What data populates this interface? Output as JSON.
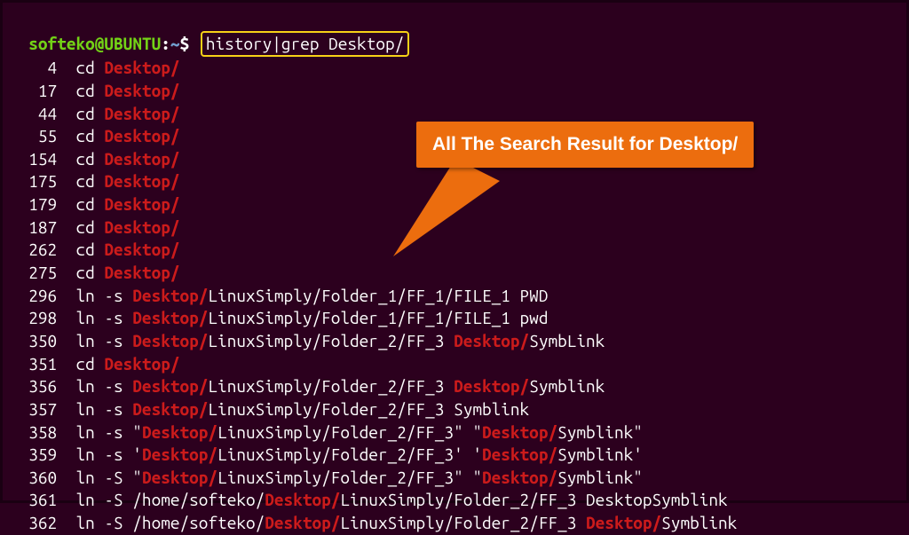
{
  "prompt": {
    "user": "softeko",
    "at": "@",
    "host": "UBUNTU",
    "colon": ":",
    "path": "~",
    "dollar": "$",
    "command": "history|grep Desktop/"
  },
  "callout": {
    "text": "All The Search Result for Desktop/"
  },
  "history": [
    {
      "n": "4",
      "segs": [
        {
          "t": "cd ",
          "m": 0
        },
        {
          "t": "Desktop/",
          "m": 1
        }
      ]
    },
    {
      "n": "17",
      "segs": [
        {
          "t": "cd ",
          "m": 0
        },
        {
          "t": "Desktop/",
          "m": 1
        }
      ]
    },
    {
      "n": "44",
      "segs": [
        {
          "t": "cd ",
          "m": 0
        },
        {
          "t": "Desktop/",
          "m": 1
        }
      ]
    },
    {
      "n": "55",
      "segs": [
        {
          "t": "cd ",
          "m": 0
        },
        {
          "t": "Desktop/",
          "m": 1
        }
      ]
    },
    {
      "n": "154",
      "segs": [
        {
          "t": "cd ",
          "m": 0
        },
        {
          "t": "Desktop/",
          "m": 1
        }
      ]
    },
    {
      "n": "175",
      "segs": [
        {
          "t": "cd ",
          "m": 0
        },
        {
          "t": "Desktop/",
          "m": 1
        }
      ]
    },
    {
      "n": "179",
      "segs": [
        {
          "t": "cd ",
          "m": 0
        },
        {
          "t": "Desktop/",
          "m": 1
        }
      ]
    },
    {
      "n": "187",
      "segs": [
        {
          "t": "cd ",
          "m": 0
        },
        {
          "t": "Desktop/",
          "m": 1
        }
      ]
    },
    {
      "n": "262",
      "segs": [
        {
          "t": "cd ",
          "m": 0
        },
        {
          "t": "Desktop/",
          "m": 1
        }
      ]
    },
    {
      "n": "275",
      "segs": [
        {
          "t": "cd ",
          "m": 0
        },
        {
          "t": "Desktop/",
          "m": 1
        }
      ]
    },
    {
      "n": "296",
      "segs": [
        {
          "t": "ln -s ",
          "m": 0
        },
        {
          "t": "Desktop/",
          "m": 1
        },
        {
          "t": "LinuxSimply/Folder_1/FF_1/FILE_1 PWD",
          "m": 0
        }
      ]
    },
    {
      "n": "298",
      "segs": [
        {
          "t": "ln -s ",
          "m": 0
        },
        {
          "t": "Desktop/",
          "m": 1
        },
        {
          "t": "LinuxSimply/Folder_1/FF_1/FILE_1 pwd",
          "m": 0
        }
      ]
    },
    {
      "n": "350",
      "segs": [
        {
          "t": "ln -s ",
          "m": 0
        },
        {
          "t": "Desktop/",
          "m": 1
        },
        {
          "t": "LinuxSimply/Folder_2/FF_3 ",
          "m": 0
        },
        {
          "t": "Desktop/",
          "m": 1
        },
        {
          "t": "SymbLink",
          "m": 0
        }
      ]
    },
    {
      "n": "351",
      "segs": [
        {
          "t": "cd ",
          "m": 0
        },
        {
          "t": "Desktop/",
          "m": 1
        }
      ]
    },
    {
      "n": "356",
      "segs": [
        {
          "t": "ln -s ",
          "m": 0
        },
        {
          "t": "Desktop/",
          "m": 1
        },
        {
          "t": "LinuxSimply/Folder_2/FF_3 ",
          "m": 0
        },
        {
          "t": "Desktop/",
          "m": 1
        },
        {
          "t": "Symblink",
          "m": 0
        }
      ]
    },
    {
      "n": "357",
      "segs": [
        {
          "t": "ln -s ",
          "m": 0
        },
        {
          "t": "Desktop/",
          "m": 1
        },
        {
          "t": "LinuxSimply/Folder_2/FF_3 Symblink",
          "m": 0
        }
      ]
    },
    {
      "n": "358",
      "segs": [
        {
          "t": "ln -s \"",
          "m": 0
        },
        {
          "t": "Desktop/",
          "m": 1
        },
        {
          "t": "LinuxSimply/Folder_2/FF_3\" \"",
          "m": 0
        },
        {
          "t": "Desktop/",
          "m": 1
        },
        {
          "t": "Symblink\"",
          "m": 0
        }
      ]
    },
    {
      "n": "359",
      "segs": [
        {
          "t": "ln -s '",
          "m": 0
        },
        {
          "t": "Desktop/",
          "m": 1
        },
        {
          "t": "LinuxSimply/Folder_2/FF_3' '",
          "m": 0
        },
        {
          "t": "Desktop/",
          "m": 1
        },
        {
          "t": "Symblink'",
          "m": 0
        }
      ]
    },
    {
      "n": "360",
      "segs": [
        {
          "t": "ln -S \"",
          "m": 0
        },
        {
          "t": "Desktop/",
          "m": 1
        },
        {
          "t": "LinuxSimply/Folder_2/FF_3\" \"",
          "m": 0
        },
        {
          "t": "Desktop/",
          "m": 1
        },
        {
          "t": "Symblink\"",
          "m": 0
        }
      ]
    },
    {
      "n": "361",
      "segs": [
        {
          "t": "ln -S /home/softeko/",
          "m": 0
        },
        {
          "t": "Desktop/",
          "m": 1
        },
        {
          "t": "LinuxSimply/Folder_2/FF_3 DesktopSymblink",
          "m": 0
        }
      ]
    },
    {
      "n": "362",
      "segs": [
        {
          "t": "ln -S /home/softeko/",
          "m": 0
        },
        {
          "t": "Desktop/",
          "m": 1
        },
        {
          "t": "LinuxSimply/Folder_2/FF_3 ",
          "m": 0
        },
        {
          "t": "Desktop/",
          "m": 1
        },
        {
          "t": "Symblink",
          "m": 0
        }
      ]
    }
  ]
}
